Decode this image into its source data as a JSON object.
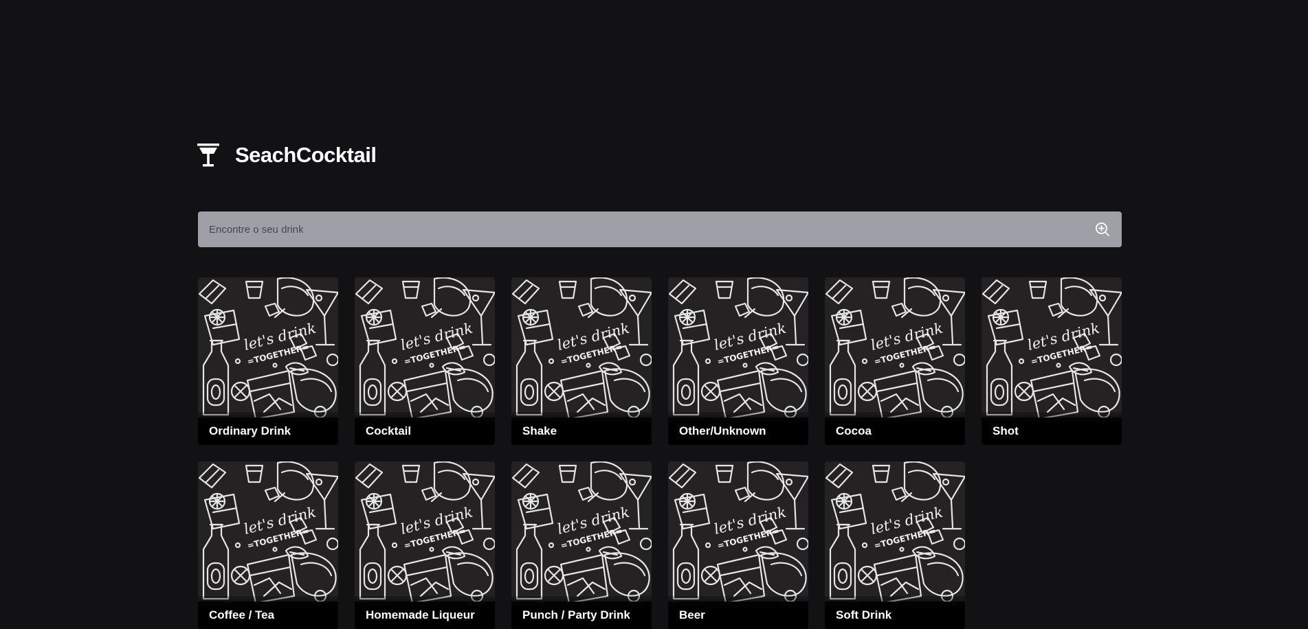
{
  "header": {
    "title": "SeachCocktail",
    "logo_icon": "cocktail-glass-icon"
  },
  "search": {
    "placeholder": "Encontre o seu drink",
    "value": "",
    "button_icon": "zoom-in-search-icon"
  },
  "categories": [
    {
      "label": "Ordinary Drink",
      "image": "lets-drink-together-pattern"
    },
    {
      "label": "Cocktail",
      "image": "lets-drink-together-pattern"
    },
    {
      "label": "Shake",
      "image": "lets-drink-together-pattern"
    },
    {
      "label": "Other/Unknown",
      "image": "lets-drink-together-pattern"
    },
    {
      "label": "Cocoa",
      "image": "lets-drink-together-pattern"
    },
    {
      "label": "Shot",
      "image": "lets-drink-together-pattern"
    },
    {
      "label": "Coffee / Tea",
      "image": "lets-drink-together-pattern"
    },
    {
      "label": "Homemade Liqueur",
      "image": "lets-drink-together-pattern"
    },
    {
      "label": "Punch / Party Drink",
      "image": "lets-drink-together-pattern"
    },
    {
      "label": "Beer",
      "image": "lets-drink-together-pattern"
    },
    {
      "label": "Soft Drink",
      "image": "lets-drink-together-pattern"
    }
  ],
  "pattern_text": {
    "line1": "let's drink",
    "line2": "=TOGETHER="
  },
  "colors": {
    "background": "#121214",
    "search_bg": "#9f9fa7",
    "card_bg": "#050505",
    "text": "#ffffff"
  }
}
